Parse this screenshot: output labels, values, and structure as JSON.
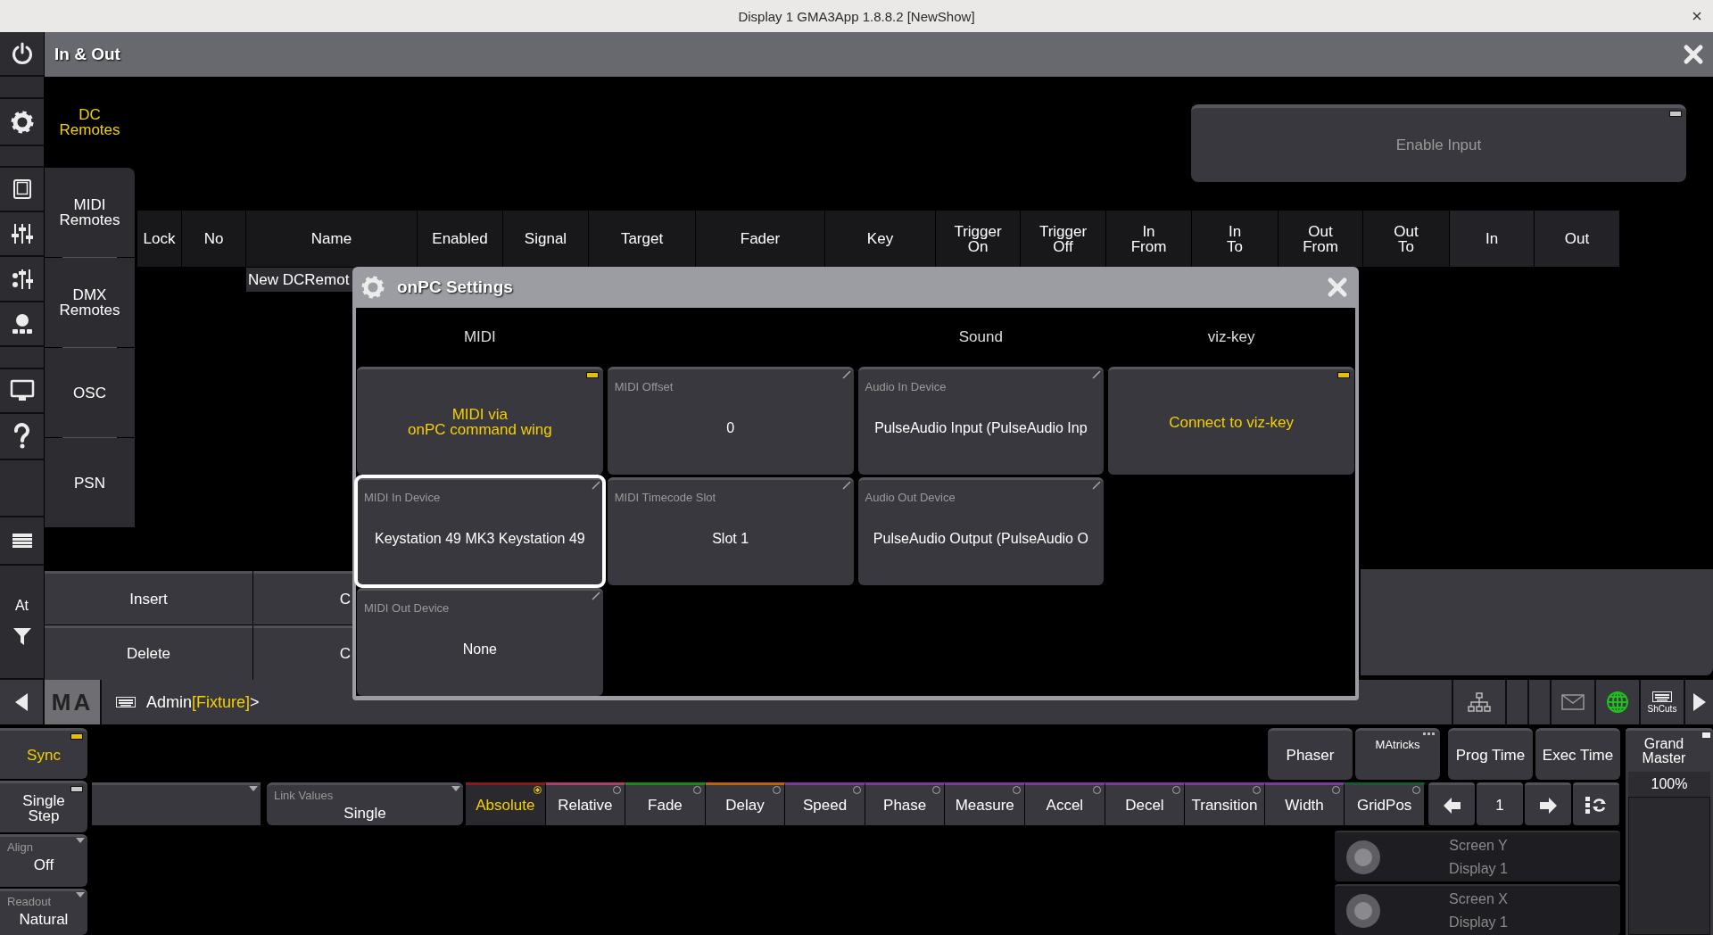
{
  "window": {
    "title": "Display 1 GMA3App 1.8.8.2 [NewShow]"
  },
  "icon_bar": {
    "at_label": "At"
  },
  "panel": {
    "title": "In & Out"
  },
  "tabs": [
    {
      "label": "DC\nRemotes",
      "selected": true
    },
    {
      "label": "MIDI\nRemotes",
      "selected": false
    },
    {
      "label": "DMX\nRemotes",
      "selected": false
    },
    {
      "label": "OSC",
      "selected": false
    },
    {
      "label": "PSN",
      "selected": false
    }
  ],
  "enable_input": {
    "label": "Enable Input",
    "on": false
  },
  "table": {
    "columns": [
      "Lock",
      "No",
      "Name",
      "Enabled",
      "Signal",
      "Target",
      "Fader",
      "Key",
      "Trigger\nOn",
      "Trigger\nOff",
      "In\nFrom",
      "In\nTo",
      "Out\nFrom",
      "Out\nTo",
      "In",
      "Out"
    ],
    "rows": [
      {
        "name": "New DCRemot"
      }
    ]
  },
  "edit_buttons": [
    {
      "label": "Insert"
    },
    {
      "label": "C"
    },
    {
      "label": "Delete"
    },
    {
      "label": "C"
    }
  ],
  "dialog": {
    "title": "onPC Settings",
    "columns": [
      {
        "header": "MIDI",
        "tiles": [
          {
            "kind": "toggle",
            "label": "MIDI via\nonPC command wing",
            "on": true
          },
          {
            "kind": "property",
            "title": "MIDI In Device",
            "value": "Keystation 49 MK3 Keystation 49",
            "focused": true
          },
          {
            "kind": "property",
            "title": "MIDI Out Device",
            "value": "None",
            "focused": false
          }
        ]
      },
      {
        "tiles": [
          {
            "kind": "property",
            "title": "MIDI Offset",
            "value": "0",
            "focused": false
          },
          {
            "kind": "property",
            "title": "MIDI Timecode Slot",
            "value": "Slot 1",
            "focused": false
          }
        ]
      },
      {
        "header": "Sound",
        "tiles": [
          {
            "kind": "property",
            "title": "Audio In Device",
            "value": "PulseAudio Input (PulseAudio Inp",
            "focused": false
          },
          {
            "kind": "property",
            "title": "Audio Out Device",
            "value": "PulseAudio Output (PulseAudio O",
            "focused": false
          }
        ]
      },
      {
        "header": "viz-key",
        "tiles": [
          {
            "kind": "toggle",
            "label": "Connect to viz-key",
            "on": true
          }
        ]
      }
    ]
  },
  "command_line": {
    "logo": "MA",
    "user": "Admin",
    "context": "[Fixture]",
    "suffix": ">"
  },
  "toolbar": {
    "shortcuts_label": "ShCuts"
  },
  "left_controls": [
    {
      "kind": "toggle",
      "label": "Sync",
      "on": true
    },
    {
      "kind": "toggle",
      "label": "Single\nStep",
      "on": false
    },
    {
      "kind": "dropdown",
      "title": "Align",
      "value": "Off"
    },
    {
      "kind": "dropdown",
      "title": "Readout",
      "value": "Natural"
    }
  ],
  "top_buttons": [
    {
      "label": "Phaser",
      "kind": "plain"
    },
    {
      "label": "MAtricks",
      "kind": "menu"
    },
    {
      "label": "Prog Time",
      "kind": "plain"
    },
    {
      "label": "Exec Time",
      "kind": "plain"
    }
  ],
  "selectors": [
    {
      "kind": "dropdown"
    },
    {
      "kind": "dropdown",
      "title": "Link Values",
      "value": "Single"
    }
  ],
  "presets": [
    {
      "label": "Absolute",
      "color": "#8a1a1a",
      "selected": true
    },
    {
      "label": "Relative",
      "color": "#a8406a",
      "selected": false
    },
    {
      "label": "Fade",
      "color": "#1a8a1a",
      "selected": false
    },
    {
      "label": "Delay",
      "color": "#c0600a",
      "selected": false
    },
    {
      "label": "Speed",
      "color": "#7c3a9a",
      "selected": false
    },
    {
      "label": "Phase",
      "color": "#7c3a9a",
      "selected": false
    },
    {
      "label": "Measure",
      "color": "#7c3a9a",
      "selected": false
    },
    {
      "label": "Accel",
      "color": "#7c3a9a",
      "selected": false
    },
    {
      "label": "Decel",
      "color": "#7c3a9a",
      "selected": false
    },
    {
      "label": "Transition",
      "color": "#7c3a9a",
      "selected": false
    },
    {
      "label": "Width",
      "color": "#7c3a9a",
      "selected": false
    },
    {
      "label": "GridPos",
      "color": "#165a30",
      "selected": false
    }
  ],
  "step": {
    "value": "1"
  },
  "encoders": [
    {
      "title": "Screen Y",
      "value": "Display 1"
    },
    {
      "title": "Screen X",
      "value": "Display 1"
    }
  ],
  "grand_master": {
    "title": "Grand\nMaster",
    "value": "100%"
  }
}
